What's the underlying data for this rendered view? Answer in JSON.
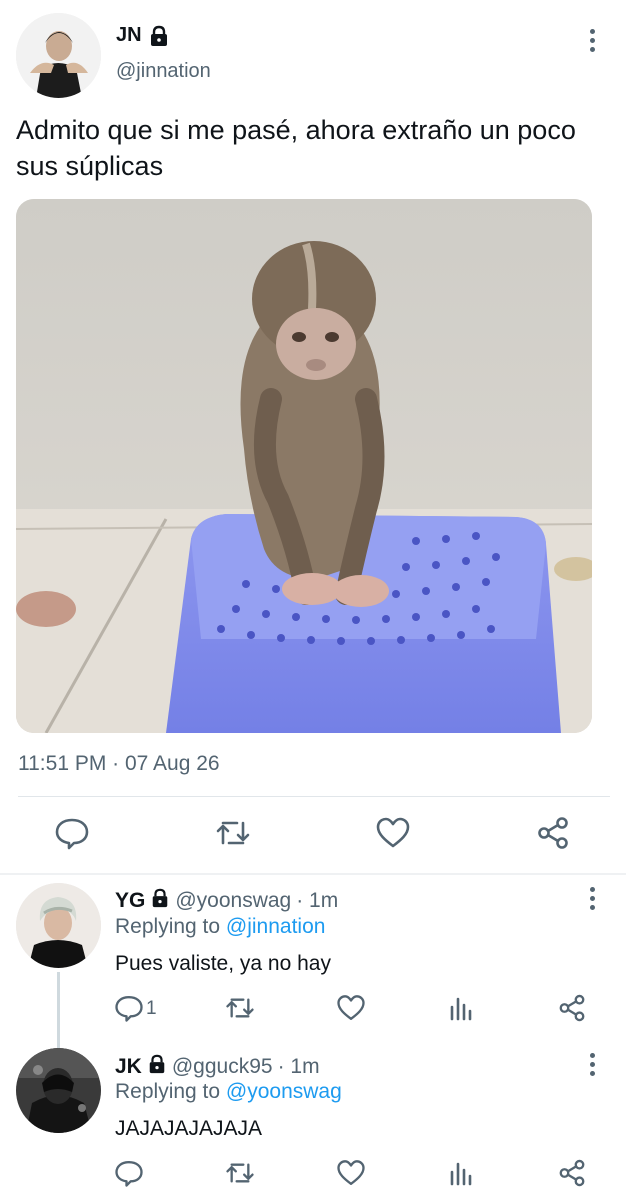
{
  "main_tweet": {
    "display_name": "JN",
    "handle": "@jinnation",
    "text": "Admito que si me pasé, ahora extraño un poco sus súplicas",
    "timestamp": "11:51 PM · 07 Aug 26",
    "icons": {
      "protected": "lock-icon",
      "more": "more-vertical-icon",
      "reply": "reply-icon",
      "retweet": "retweet-icon",
      "like": "heart-icon",
      "share": "share-icon"
    }
  },
  "replies": [
    {
      "display_name": "YG",
      "handle": "@yoonswag",
      "time": "· 1m",
      "replying_label": "Replying to",
      "replying_to": "@jinnation",
      "text": "Pues valiste, ya no hay",
      "reply_count": "1"
    },
    {
      "display_name": "JK",
      "handle": "@gguck95",
      "time": "· 1m",
      "replying_label": "Replying to",
      "replying_to": "@yoonswag",
      "text": "JAJAJAJAJAJA",
      "reply_count": ""
    }
  ],
  "colors": {
    "accent": "#1d9bf0",
    "secondary_text": "#536471",
    "primary_text": "#0f1419"
  }
}
